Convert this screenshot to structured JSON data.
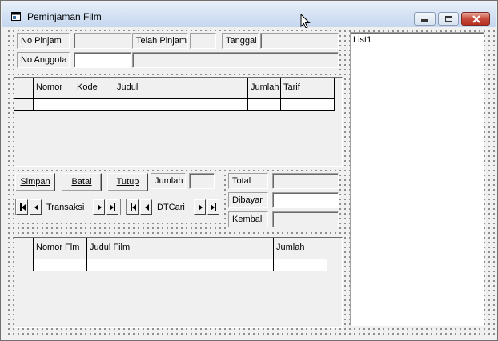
{
  "window": {
    "title": "Peminjaman Film"
  },
  "header_panel": {
    "no_pinjam_label": "No Pinjam",
    "telah_pinjam_label": "Telah Pinjam",
    "tanggal_label": "Tanggal",
    "no_anggota_label": "No Anggota"
  },
  "grid1": {
    "columns": [
      "Nomor",
      "Kode",
      "Judul",
      "Jumlah",
      "Tarif"
    ]
  },
  "buttons": {
    "simpan": "Simpan",
    "batal": "Batal",
    "tutup": "Tutup"
  },
  "jumlah_label": "Jumlah",
  "data_controls": {
    "transaksi": "Transaksi",
    "dtcari": "DTCari"
  },
  "totals": {
    "total_label": "Total",
    "dibayar_label": "Dibayar",
    "kembali_label": "Kembali"
  },
  "grid2": {
    "columns": [
      "Nomor Flm",
      "Judul Film",
      "Jumlah"
    ]
  },
  "list": {
    "items": [
      "List1"
    ]
  },
  "icons": {
    "app": "window-form-icon",
    "minimize": "minimize-icon",
    "maximize": "maximize-icon",
    "close": "close-icon",
    "cursor": "mouse-pointer-icon"
  }
}
